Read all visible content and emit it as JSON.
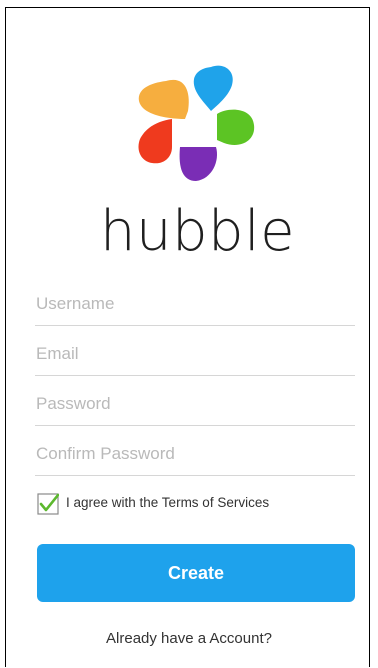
{
  "brand": {
    "name": "hubble",
    "colors": {
      "orange": "#f6ae3f",
      "blue": "#1fa3ea",
      "green": "#5cc424",
      "purple": "#7a2db5",
      "red": "#ef3a1e"
    }
  },
  "form": {
    "username": {
      "placeholder": "Username",
      "value": ""
    },
    "email": {
      "placeholder": "Email",
      "value": ""
    },
    "password": {
      "placeholder": "Password",
      "value": ""
    },
    "confirm_password": {
      "placeholder": "Confirm Password",
      "value": ""
    },
    "terms": {
      "label": "I agree with the Terms of Services",
      "checked": true,
      "check_color": "#5cb82e"
    },
    "create_label": "Create",
    "create_color": "#1ea2ec"
  },
  "footer": {
    "signin_label": "Already have a Account?"
  },
  "icons": {
    "logo": "hubble-petal-logo-icon",
    "checkbox": "checkmark-icon"
  }
}
